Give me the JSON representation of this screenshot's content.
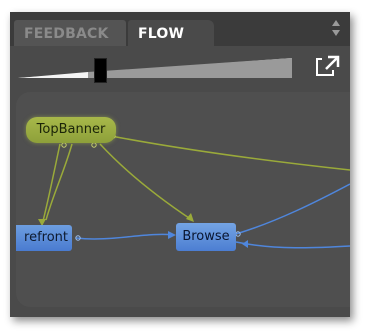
{
  "tabs": [
    {
      "label": "FEEDBACK",
      "active": false
    },
    {
      "label": "FLOW",
      "active": true
    }
  ],
  "zoom_slider": {
    "value": 0.27
  },
  "flow": {
    "nodes": {
      "topbanner": "TopBanner",
      "storefront": "refront",
      "browse": "Browse"
    }
  },
  "colors": {
    "panel_bg": "#4a4a4a",
    "tab_active_text": "#ffffff",
    "tab_inactive_text": "#8a8a8a",
    "topbanner_node": "#9aac42",
    "flow_green": "#a4b53c",
    "flow_blue": "#4f86dc",
    "page_node": "#5a8ad6"
  },
  "icons": [
    "scroll-arrows-icon",
    "popout-icon",
    "slider-handle"
  ]
}
